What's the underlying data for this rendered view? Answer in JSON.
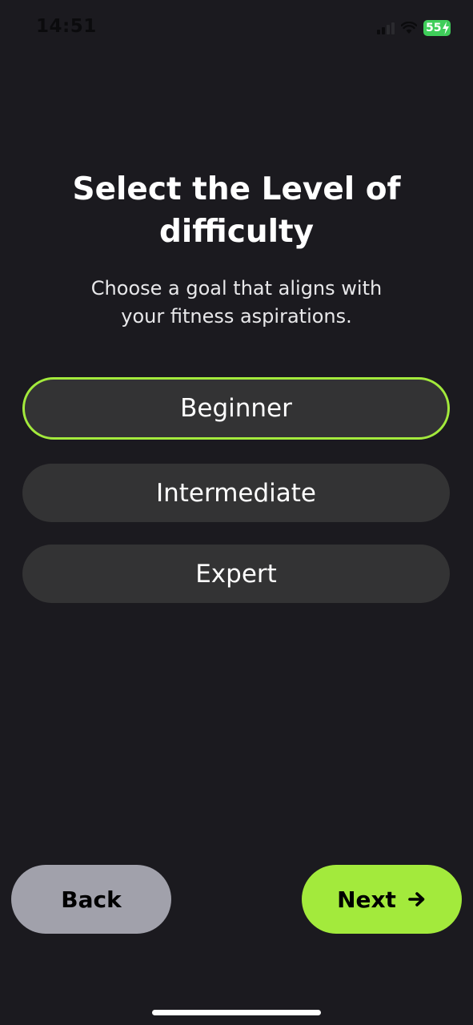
{
  "status_bar": {
    "time": "14:51",
    "battery": "55"
  },
  "header": {
    "title_line1": "Select the Level of",
    "title_line2": "difficulty",
    "subtitle_line1": "Choose a goal that aligns with",
    "subtitle_line2": "your fitness aspirations."
  },
  "options": [
    {
      "label": "Beginner",
      "selected": true
    },
    {
      "label": "Intermediate",
      "selected": false
    },
    {
      "label": "Expert",
      "selected": false
    }
  ],
  "footer": {
    "back_label": "Back",
    "next_label": "Next",
    "next_icon": "arrow-right-icon"
  },
  "colors": {
    "background": "#1b1a1f",
    "accent": "#a3ea3c",
    "option_bg": "#333334",
    "back_bg": "#a1a1ab"
  }
}
